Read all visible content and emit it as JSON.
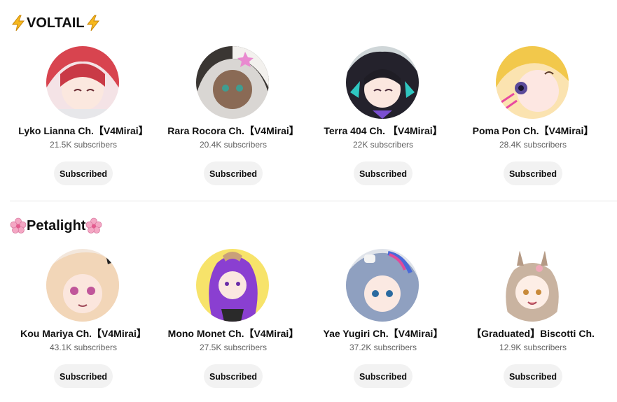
{
  "sections": [
    {
      "title": "VOLTAIL",
      "emoji": "zap-icon",
      "channels": [
        {
          "name": "Lyko Lianna Ch.【V4Mirai】",
          "subscribers": "21.5K subscribers",
          "button": "Subscribed",
          "avatar_color": "#d8444f"
        },
        {
          "name": "Rara Rocora Ch.【V4Mirai】",
          "subscribers": "20.4K subscribers",
          "button": "Subscribed",
          "avatar_color": "#8a6a55"
        },
        {
          "name": "Terra 404 Ch. 【V4Mirai】",
          "subscribers": "22K subscribers",
          "button": "Subscribed",
          "avatar_color": "#2a2e3a"
        },
        {
          "name": "Poma Pon Ch.【V4Mirai】",
          "subscribers": "28.4K subscribers",
          "button": "Subscribed",
          "avatar_color": "#f2c84b"
        }
      ]
    },
    {
      "title": "Petalight",
      "emoji": "cherry-blossom-icon",
      "channels": [
        {
          "name": "Kou Mariya Ch.【V4Mirai】",
          "subscribers": "43.1K subscribers",
          "button": "Subscribed",
          "avatar_color": "#f2d6c4"
        },
        {
          "name": "Mono Monet Ch.【V4Mirai】",
          "subscribers": "27.5K subscribers",
          "button": "Subscribed",
          "avatar_color": "#f7e36a"
        },
        {
          "name": "Yae Yugiri Ch.【V4Mirai】",
          "subscribers": "37.2K subscribers",
          "button": "Subscribed",
          "avatar_color": "#8fa0c0"
        },
        {
          "name": "【Graduated】Biscotti Ch.",
          "subscribers": "12.9K subscribers",
          "button": "Subscribed",
          "avatar_color": "#e9ddd2"
        }
      ]
    }
  ]
}
